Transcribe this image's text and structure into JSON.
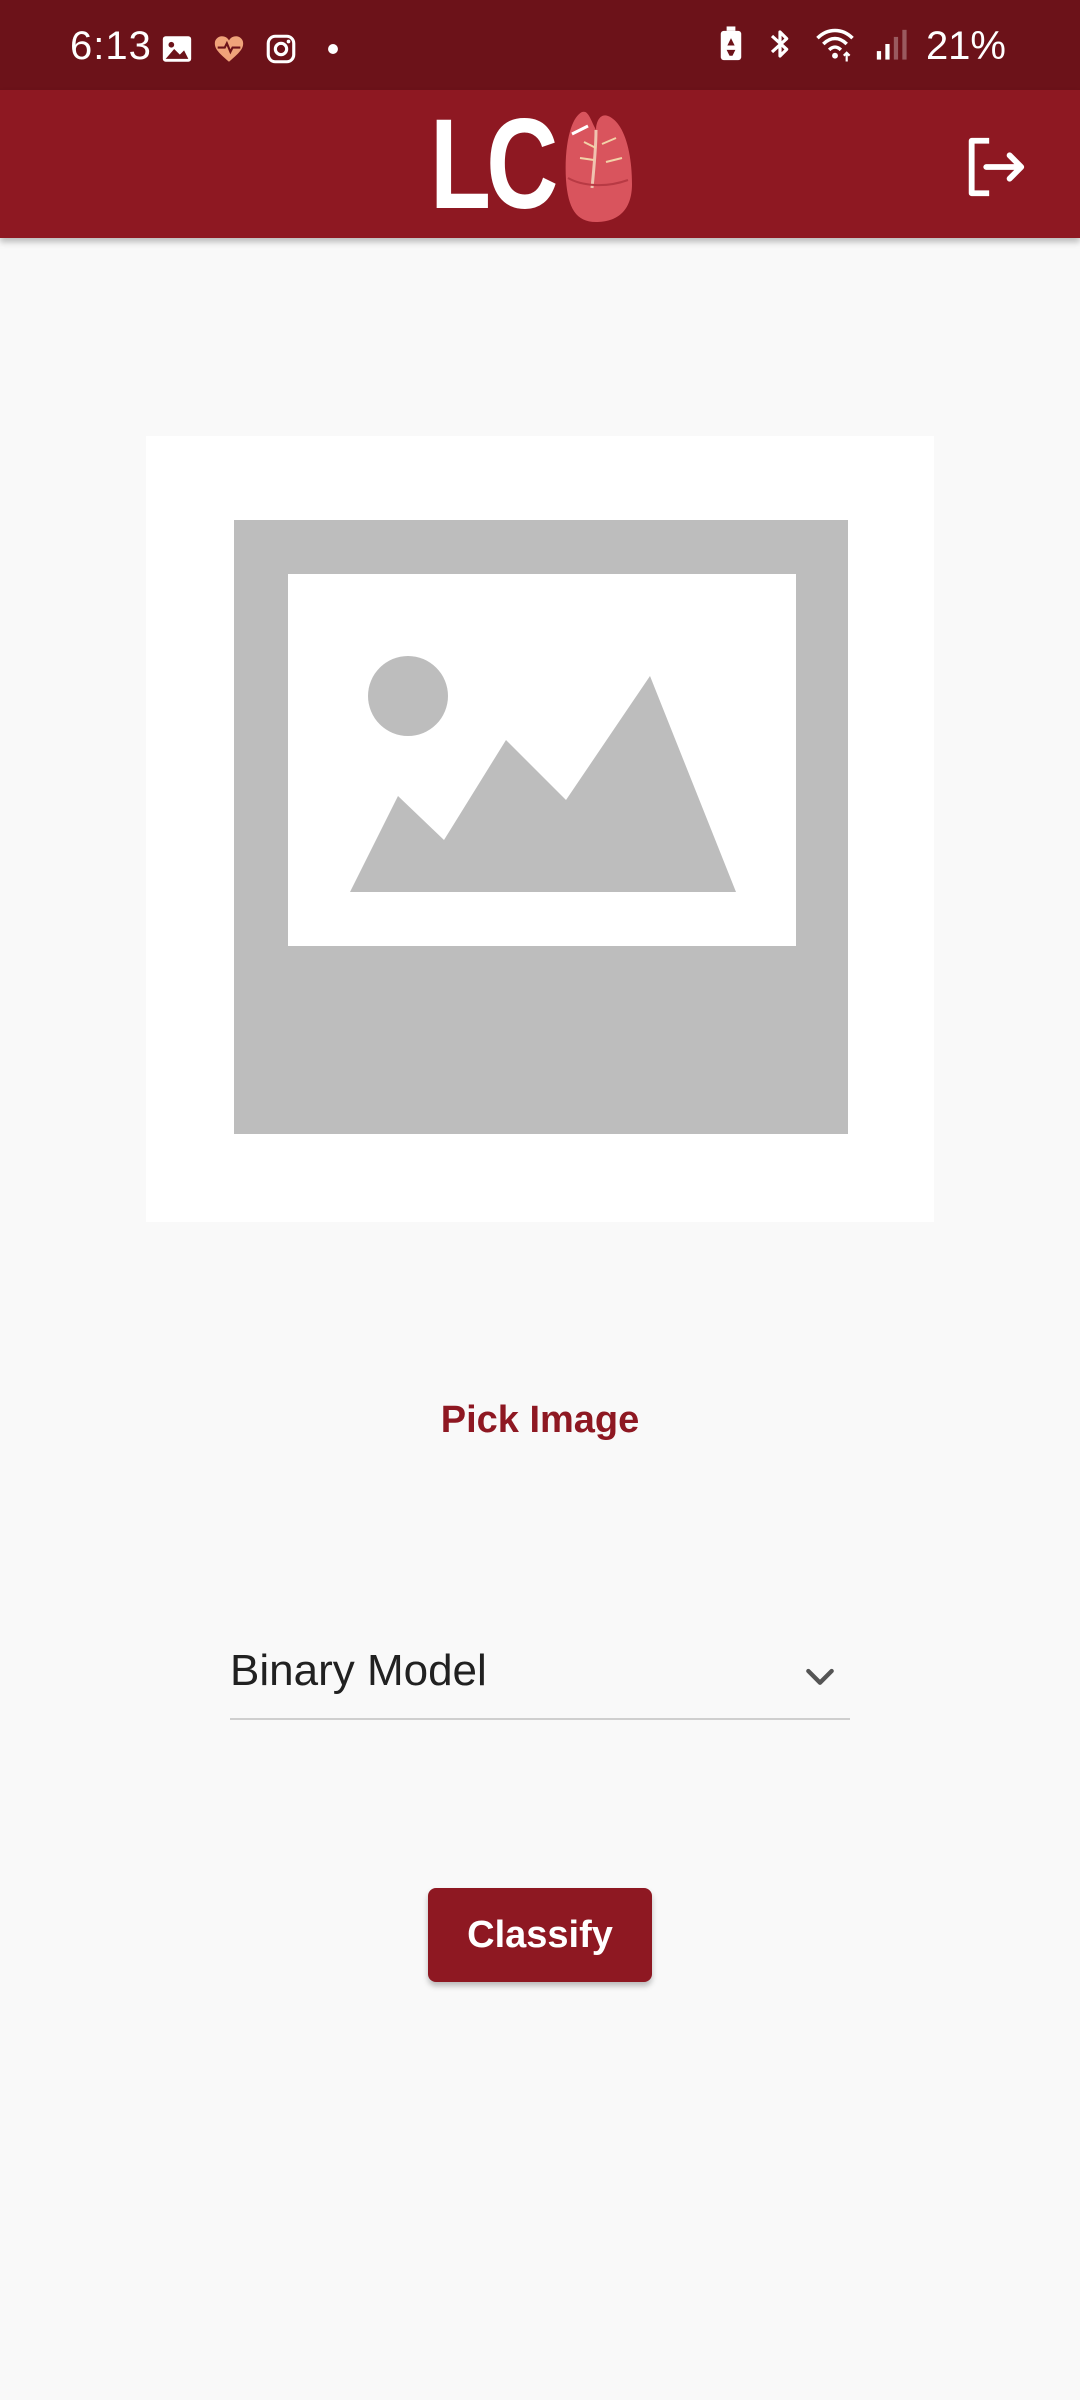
{
  "status_bar": {
    "time": "6:13",
    "battery": "21%",
    "left_icons": [
      "gallery-icon",
      "health-icon",
      "instagram-icon",
      "dot-icon"
    ],
    "right_icons": [
      "battery-saver-icon",
      "bluetooth-icon",
      "wifi-icon",
      "signal-icon"
    ]
  },
  "app_bar": {
    "logo_text": "LC",
    "logo_icon": "lung-icon",
    "action_icon": "logout-icon"
  },
  "main": {
    "image_placeholder_icon": "image-placeholder-icon",
    "pick_image_label": "Pick Image",
    "model_select": {
      "value": "Binary Model"
    },
    "classify_label": "Classify"
  },
  "colors": {
    "status_bar": "#6c1219",
    "app_bar": "#8e1822",
    "accent": "#8e1822",
    "background": "#f9f9f9",
    "placeholder_gray": "#bdbdbd"
  }
}
